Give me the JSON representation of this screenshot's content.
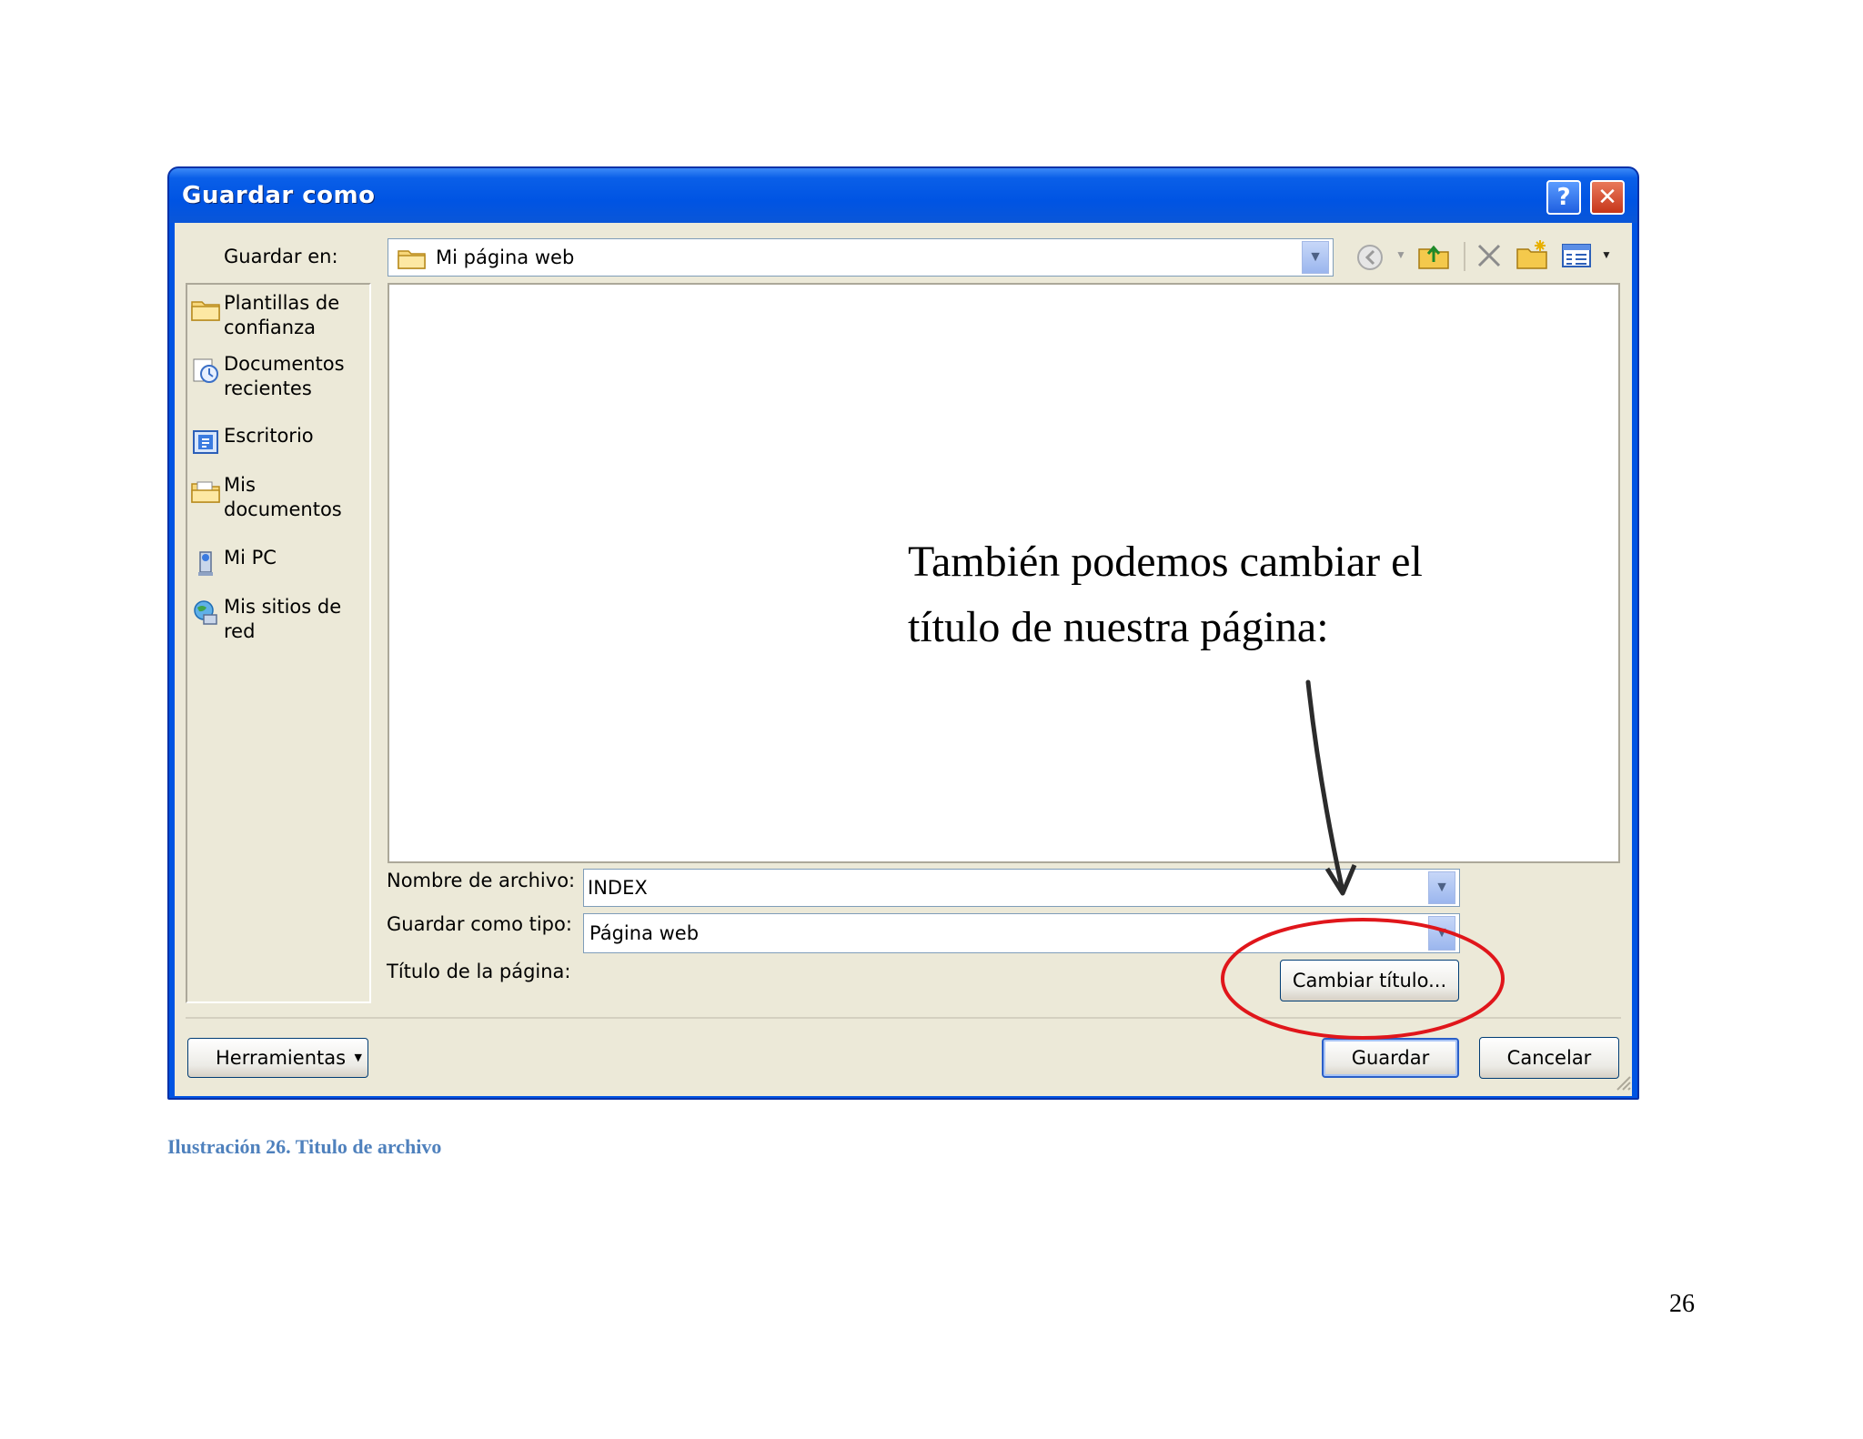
{
  "dialog": {
    "title": "Guardar como",
    "help_label": "?",
    "close_label": "✕"
  },
  "toolbar": {
    "save_in_label": "Guardar en:",
    "location": "Mi página web"
  },
  "places": [
    {
      "label_1": "Plantillas de",
      "label_2": "confianza",
      "icon": "folder-icon"
    },
    {
      "label_1": "Documentos",
      "label_2": "recientes",
      "icon": "recent-documents-icon"
    },
    {
      "label_1": "Escritorio",
      "label_2": "",
      "icon": "desktop-icon"
    },
    {
      "label_1": "Mis",
      "label_2": "documentos",
      "icon": "my-documents-icon"
    },
    {
      "label_1": "Mi PC",
      "label_2": "",
      "icon": "my-computer-icon"
    },
    {
      "label_1": "Mis sitios de",
      "label_2": "red",
      "icon": "network-places-icon"
    }
  ],
  "form": {
    "filename_label": "Nombre de archivo:",
    "filename_value": "INDEX",
    "filetype_label": "Guardar como tipo:",
    "filetype_value": "Página web",
    "pagetitle_label": "Título de la página:",
    "change_title_button": "Cambiar título..."
  },
  "buttons": {
    "tools": "Herramientas",
    "save": "Guardar",
    "cancel": "Cancelar"
  },
  "annotation": {
    "line_1": "También podemos cambiar  el",
    "line_2": "título de nuestra página:",
    "highlight_color": "#e0161b"
  },
  "caption": "Ilustración 26. Titulo  de archivo",
  "page_number": "26"
}
